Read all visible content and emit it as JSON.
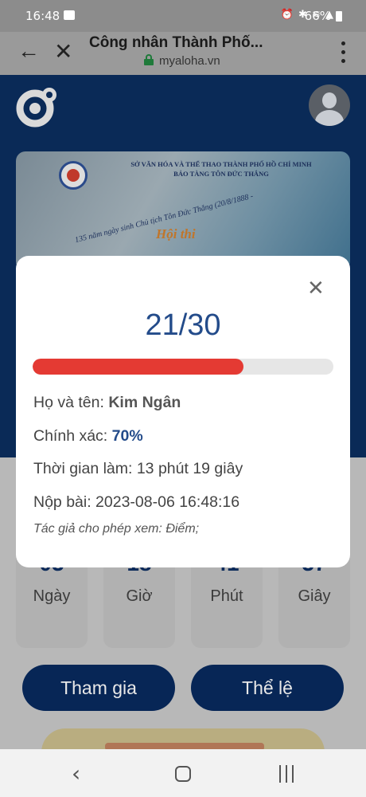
{
  "status_bar": {
    "time": "16:48",
    "battery": "66%",
    "icons": [
      "alarm-icon",
      "bluetooth-icon",
      "wifi-icon",
      "signal-icon",
      "battery-icon"
    ]
  },
  "browser": {
    "title": "Công nhân Thành Phố...",
    "url": "myaloha.vn"
  },
  "banner": {
    "org_line1": "SỞ VĂN HÓA VÀ THỂ THAO THÀNH PHỐ HỒ CHÍ MINH",
    "org_line2": "BẢO TÀNG TÔN ĐỨC THẮNG",
    "arc_text": "135 năm ngày sinh Chủ tịch Tôn Đức Thắng (20/8/1888 -",
    "contest": "Hội thi"
  },
  "countdown": [
    {
      "value": "03",
      "unit": "Ngày"
    },
    {
      "value": "18",
      "unit": "Giờ"
    },
    {
      "value": "41",
      "unit": "Phút"
    },
    {
      "value": "37",
      "unit": "Giây"
    }
  ],
  "actions": {
    "join": "Tham gia",
    "rules": "Thể lệ"
  },
  "result": {
    "score": "21/30",
    "progress_fraction": 0.7,
    "name_label": "Họ và tên: ",
    "name_value": "Kim Ngân",
    "accuracy_label": "Chính xác: ",
    "accuracy_value": "70%",
    "duration": "Thời gian làm: 13 phút 19 giây",
    "submitted": "Nộp bài: 2023-08-06 16:48:16",
    "note": "Tác giả cho phép xem: Điểm;"
  },
  "colors": {
    "accent": "#234b8a",
    "progress": "#e43a33",
    "button": "#072656"
  }
}
